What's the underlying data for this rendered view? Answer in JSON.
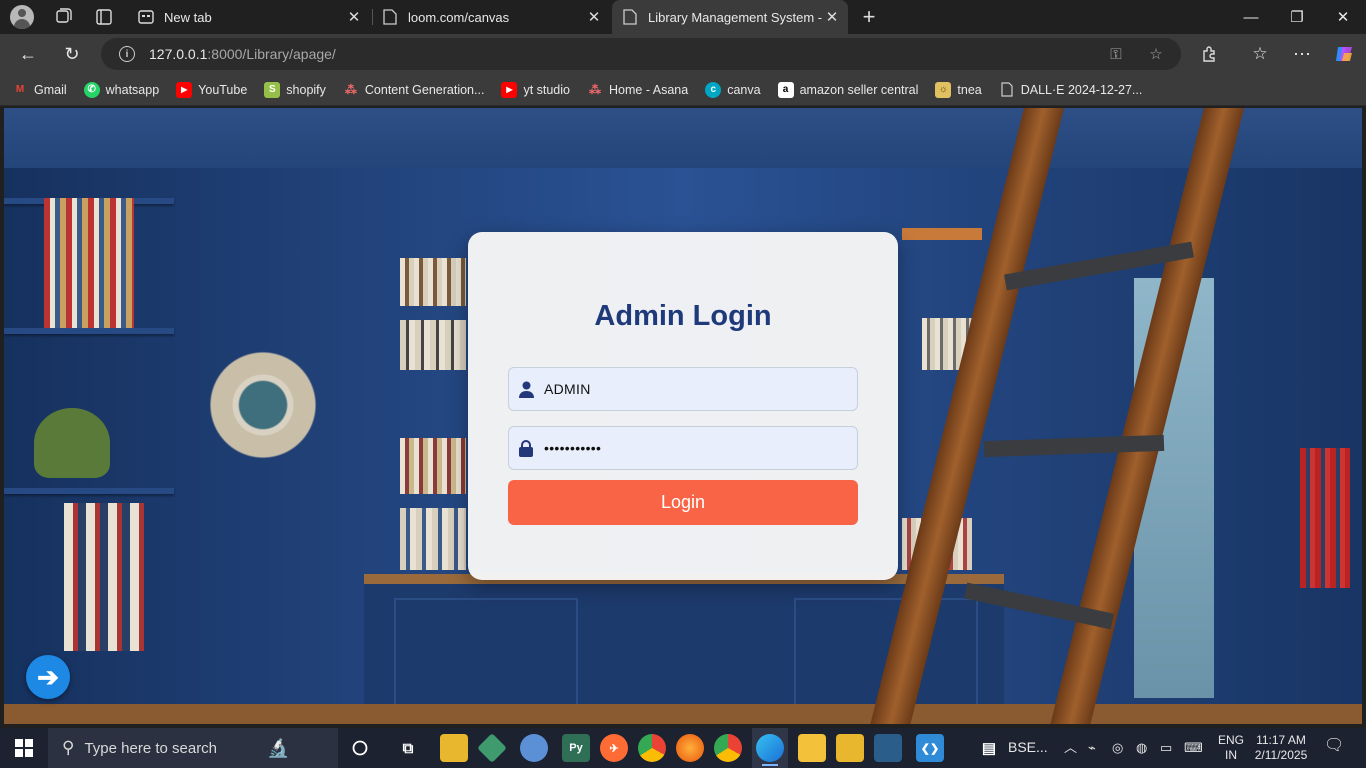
{
  "browser": {
    "tabs": [
      {
        "title": "New tab",
        "active": false
      },
      {
        "title": "loom.com/canvas",
        "active": false
      },
      {
        "title": "Library Management System - Ad",
        "active": true
      }
    ],
    "new_tab_label": "+",
    "address": {
      "host": "127.0.0.1",
      "path": ":8000/Library/apage/"
    },
    "bookmarks": [
      {
        "label": "Gmail",
        "icon": "gmail-icon",
        "color": "#ea4335"
      },
      {
        "label": "whatsapp",
        "icon": "whatsapp-icon",
        "color": "#25d366"
      },
      {
        "label": "YouTube",
        "icon": "youtube-icon",
        "color": "#ff0000"
      },
      {
        "label": "shopify",
        "icon": "shopify-icon",
        "color": "#95bf47"
      },
      {
        "label": "Content Generation...",
        "icon": "asana-dots-icon",
        "color": "#f06a6a"
      },
      {
        "label": "yt studio",
        "icon": "youtube-icon",
        "color": "#ff0000"
      },
      {
        "label": "Home - Asana",
        "icon": "asana-dots-icon",
        "color": "#f06a6a"
      },
      {
        "label": "canva",
        "icon": "canva-icon",
        "color": "#00c4cc"
      },
      {
        "label": "amazon seller central",
        "icon": "amazon-icon",
        "color": "#ffffff"
      },
      {
        "label": "tnea",
        "icon": "tnea-icon",
        "color": "#e0c060"
      },
      {
        "label": "DALL·E 2024-12-27...",
        "icon": "file-icon",
        "color": "#cccccc"
      }
    ]
  },
  "login": {
    "title": "Admin Login",
    "username": "ADMIN",
    "password_mask": "•••••••••••",
    "button_label": "Login",
    "colors": {
      "title": "#1f3a7a",
      "button": "#fa6446",
      "field_bg": "#e9eefc"
    }
  },
  "fab": {
    "icon": "arrow-right-icon",
    "color": "#1e88e5"
  },
  "taskbar": {
    "search_placeholder": "Type here to search",
    "pinned_label": "BSE...",
    "language": {
      "line1": "ENG",
      "line2": "IN"
    },
    "time": "11:17 AM",
    "date": "2/11/2025"
  }
}
